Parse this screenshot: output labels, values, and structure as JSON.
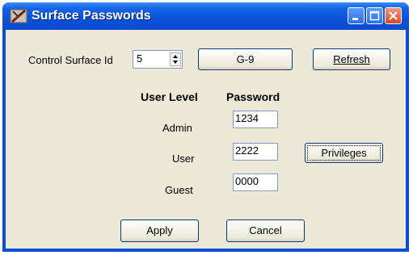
{
  "window": {
    "title": "Surface Passwords"
  },
  "control_surface": {
    "label": "Control Surface Id",
    "value": "5",
    "name_button": "G-9",
    "refresh_label": "Refresh"
  },
  "table": {
    "header_level": "User Level",
    "header_password": "Password",
    "rows": [
      {
        "level": "Admin",
        "password": "1234"
      },
      {
        "level": "User",
        "password": "2222"
      },
      {
        "level": "Guest",
        "password": "0000"
      }
    ]
  },
  "privileges_label": "Privileges",
  "actions": {
    "apply_label": "Apply",
    "cancel_label": "Cancel"
  },
  "icons": {
    "app": "surface-tool-icon",
    "minimize": "minimize-icon",
    "maximize": "maximize-icon",
    "close": "close-icon",
    "spinner": "spinner-arrows-icon"
  }
}
